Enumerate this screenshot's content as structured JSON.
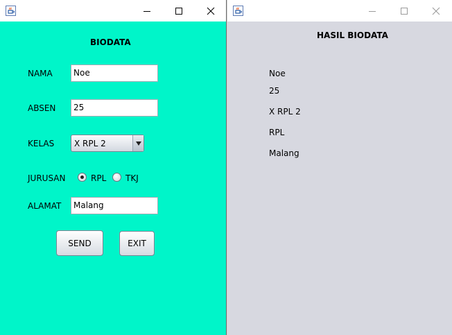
{
  "colors": {
    "form_background": "#00f5c9",
    "result_background": "#d7d8e0"
  },
  "form_window": {
    "title_text": "",
    "app_icon": "java-icon",
    "controls": {
      "minimize_icon": "minimize-icon",
      "maximize_icon": "maximize-icon",
      "close_icon": "close-icon"
    },
    "heading": "BIODATA",
    "nama": {
      "label": "NAMA",
      "value": "Noe"
    },
    "absen": {
      "label": "ABSEN",
      "value": "25"
    },
    "kelas": {
      "label": "KELAS",
      "selected": "X RPL 2"
    },
    "jurusan": {
      "label": "JURUSAN",
      "options": [
        {
          "label": "RPL",
          "checked": true
        },
        {
          "label": "TKJ",
          "checked": false
        }
      ]
    },
    "alamat": {
      "label": "ALAMAT",
      "value": "Malang"
    },
    "send_label": "SEND",
    "exit_label": "EXIT"
  },
  "result_window": {
    "title_text": "",
    "app_icon": "java-icon",
    "heading": "HASIL BIODATA",
    "lines": [
      "Noe",
      "25",
      "X RPL 2",
      "RPL",
      "Malang"
    ]
  }
}
